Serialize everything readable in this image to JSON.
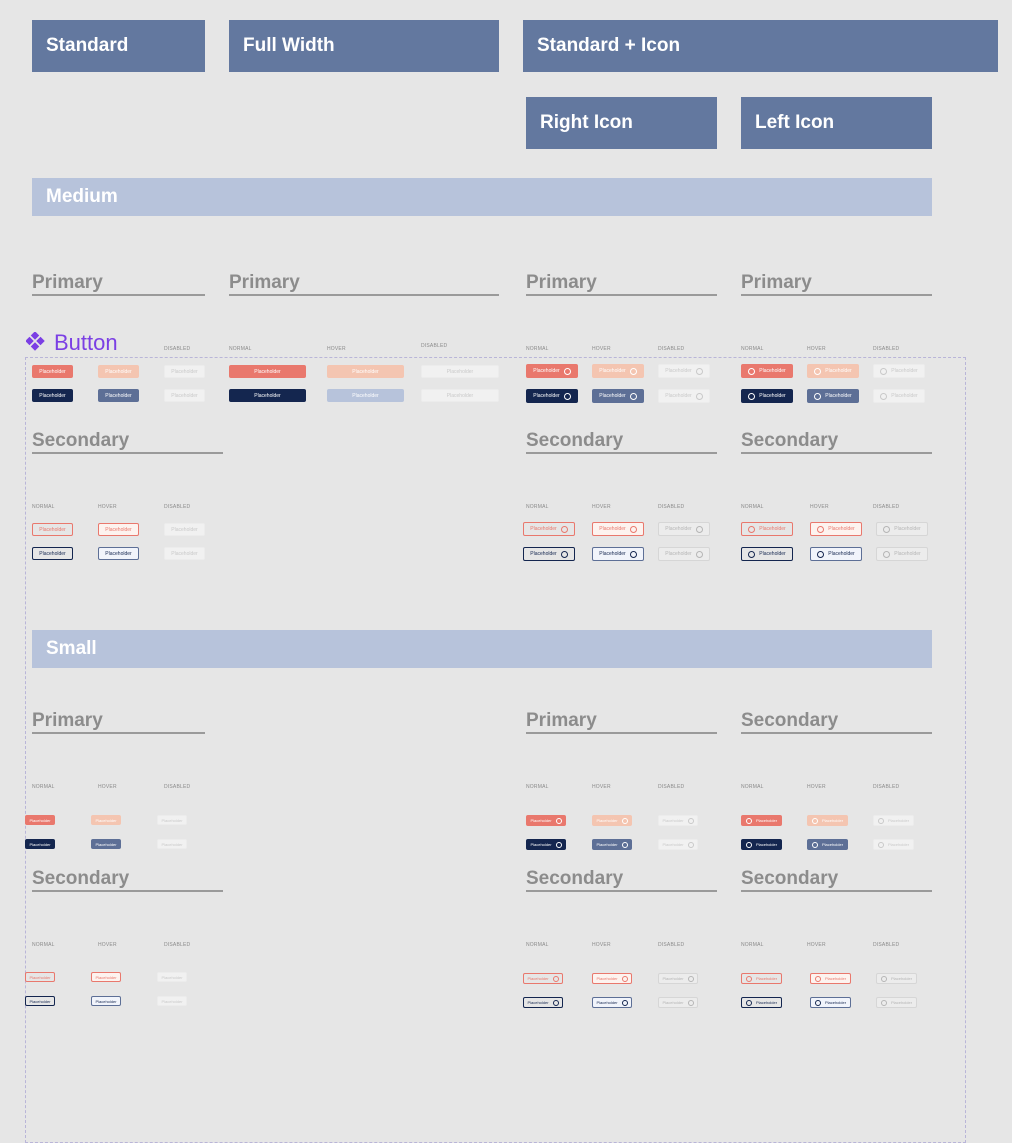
{
  "variants": {
    "standard": "Standard",
    "full_width": "Full Width",
    "standard_icon": "Standard + Icon",
    "right_icon": "Right Icon",
    "left_icon": "Left Icon"
  },
  "sizes": {
    "medium": "Medium",
    "small": "Small"
  },
  "headings": {
    "primary": "Primary",
    "secondary": "Secondary"
  },
  "logo": {
    "text": "Button",
    "color": "#7b3fe4",
    "icon": "diamond-logo-icon"
  },
  "states": {
    "normal": "NORMAL",
    "hover": "HOVER",
    "disabled": "DISABLED"
  },
  "button_label": "Placeholder",
  "colors": {
    "background": "#e6e6e6",
    "variant_header": "#63789f",
    "size_bar": "#b7c3db",
    "primary_red": "#e9786d",
    "primary_red_hover": "#f4c5b1",
    "primary_navy": "#14264f",
    "primary_navy_hover": "#5d6f96",
    "disabled": "#f1f1f1"
  }
}
